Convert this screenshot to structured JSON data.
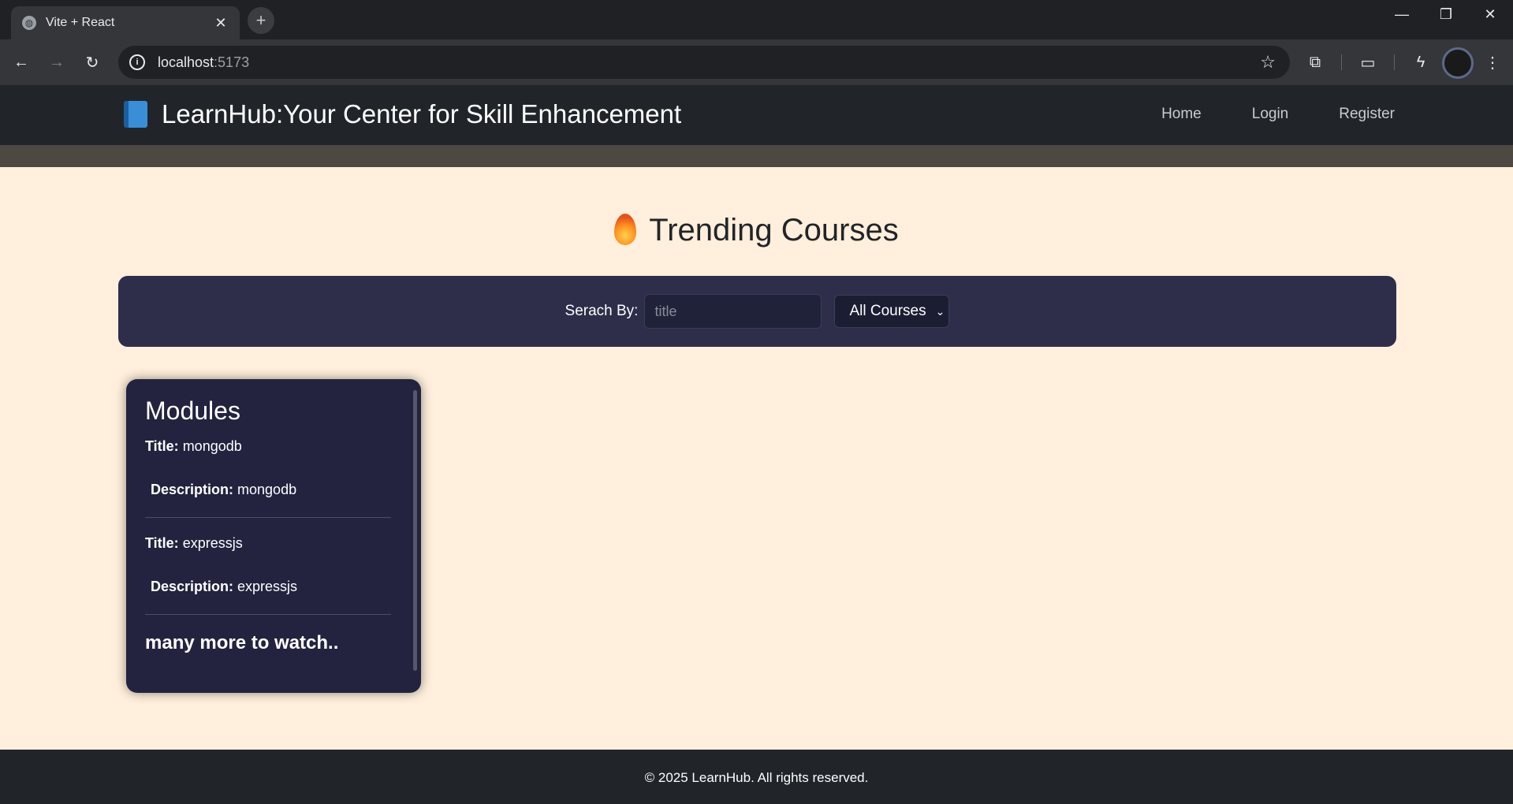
{
  "browser": {
    "tab_title": "Vite + React",
    "url_host": "localhost",
    "url_port": ":5173"
  },
  "header": {
    "brand": "LearnHub:Your Center for Skill Enhancement",
    "nav": [
      "Home",
      "Login",
      "Register"
    ]
  },
  "main": {
    "title": "Trending Courses",
    "search": {
      "label": "Serach By:",
      "placeholder": "title",
      "filter": "All Courses"
    },
    "card": {
      "heading": "Modules",
      "title_label": "Title:",
      "desc_label": "Description:",
      "modules": [
        {
          "title": "mongodb",
          "description": "mongodb"
        },
        {
          "title": "expressjs",
          "description": "expressjs"
        }
      ],
      "more": "many more to watch.."
    }
  },
  "footer": {
    "text": "© 2025 LearnHub. All rights reserved."
  }
}
